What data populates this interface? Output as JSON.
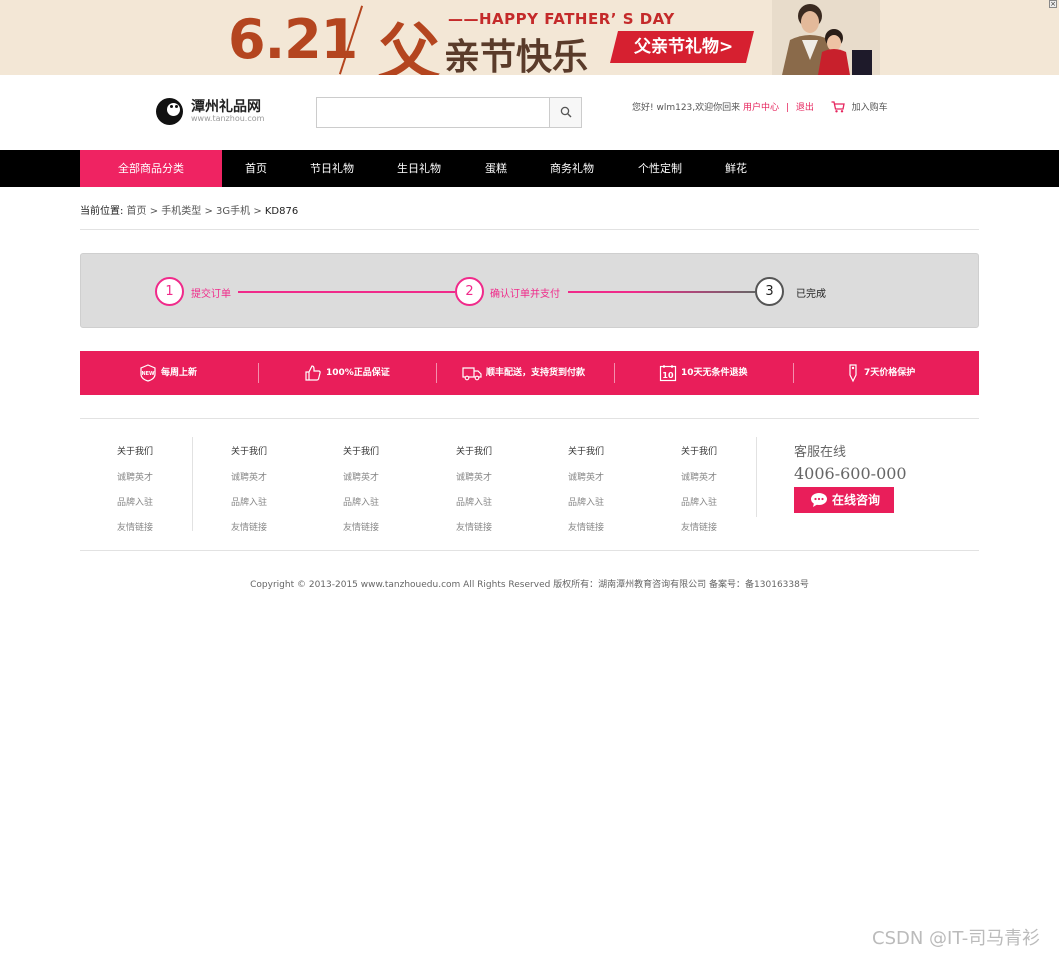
{
  "banner": {
    "close_label": "×",
    "date": "6.21",
    "fu": "父",
    "happy": "——HAPPY FATHER’ S DAY",
    "main": "亲节快乐",
    "gift_label": "父亲节礼物>"
  },
  "header": {
    "logo_name": "潭州礼品网",
    "logo_url": "www.tanzhou.com",
    "search": {
      "value": "",
      "placeholder": ""
    },
    "user_greeting": "您好! wlm123,欢迎你回来",
    "user_center": "用户中心",
    "divider": "|",
    "logout": "退出",
    "cart_label": "加入购车"
  },
  "nav": {
    "all_label": "全部商品分类",
    "items": [
      "首页",
      "节日礼物",
      "生日礼物",
      "蛋糕",
      "商务礼物",
      "个性定制",
      "鲜花"
    ]
  },
  "breadcrumb": {
    "lead": "当前位置:",
    "path": " 首页 > 手机类型 > 3G手机 > ",
    "current": "KD876"
  },
  "steps": [
    {
      "num": "1",
      "label": "提交订单"
    },
    {
      "num": "2",
      "label": "确认订单并支付"
    },
    {
      "num": "3",
      "label": "已完成"
    }
  ],
  "features": [
    "每周上新",
    "100%正品保证",
    "顺丰配送，支持货到付款",
    "10天无条件退换",
    "7天价格保护"
  ],
  "feature_icon_new": "NEW",
  "feature_icon_ten": "10",
  "footer_cols": [
    {
      "head": "关于我们",
      "links": [
        "诚聘英才",
        "品牌入驻",
        "友情链接"
      ]
    },
    {
      "head": "关于我们",
      "links": [
        "诚聘英才",
        "品牌入驻",
        "友情链接"
      ]
    },
    {
      "head": "关于我们",
      "links": [
        "诚聘英才",
        "品牌入驻",
        "友情链接"
      ]
    },
    {
      "head": "关于我们",
      "links": [
        "诚聘英才",
        "品牌入驻",
        "友情链接"
      ]
    },
    {
      "head": "关于我们",
      "links": [
        "诚聘英才",
        "品牌入驻",
        "友情链接"
      ]
    },
    {
      "head": "关于我们",
      "links": [
        "诚聘英才",
        "品牌入驻",
        "友情链接"
      ]
    }
  ],
  "service": {
    "title": "客服在线",
    "phone": "4006-600-000",
    "button": "在线咨询"
  },
  "copyright": "Copyright © 2013-2015 www.tanzhouedu.com All Rights Reserved 版权所有：湖南潭州教育咨询有限公司 备案号：备13016338号",
  "watermark": "CSDN @IT-司马青衫",
  "colors": {
    "accent": "#e91e5a",
    "nav_bg": "#000000",
    "step_pink": "#f02a8a"
  }
}
